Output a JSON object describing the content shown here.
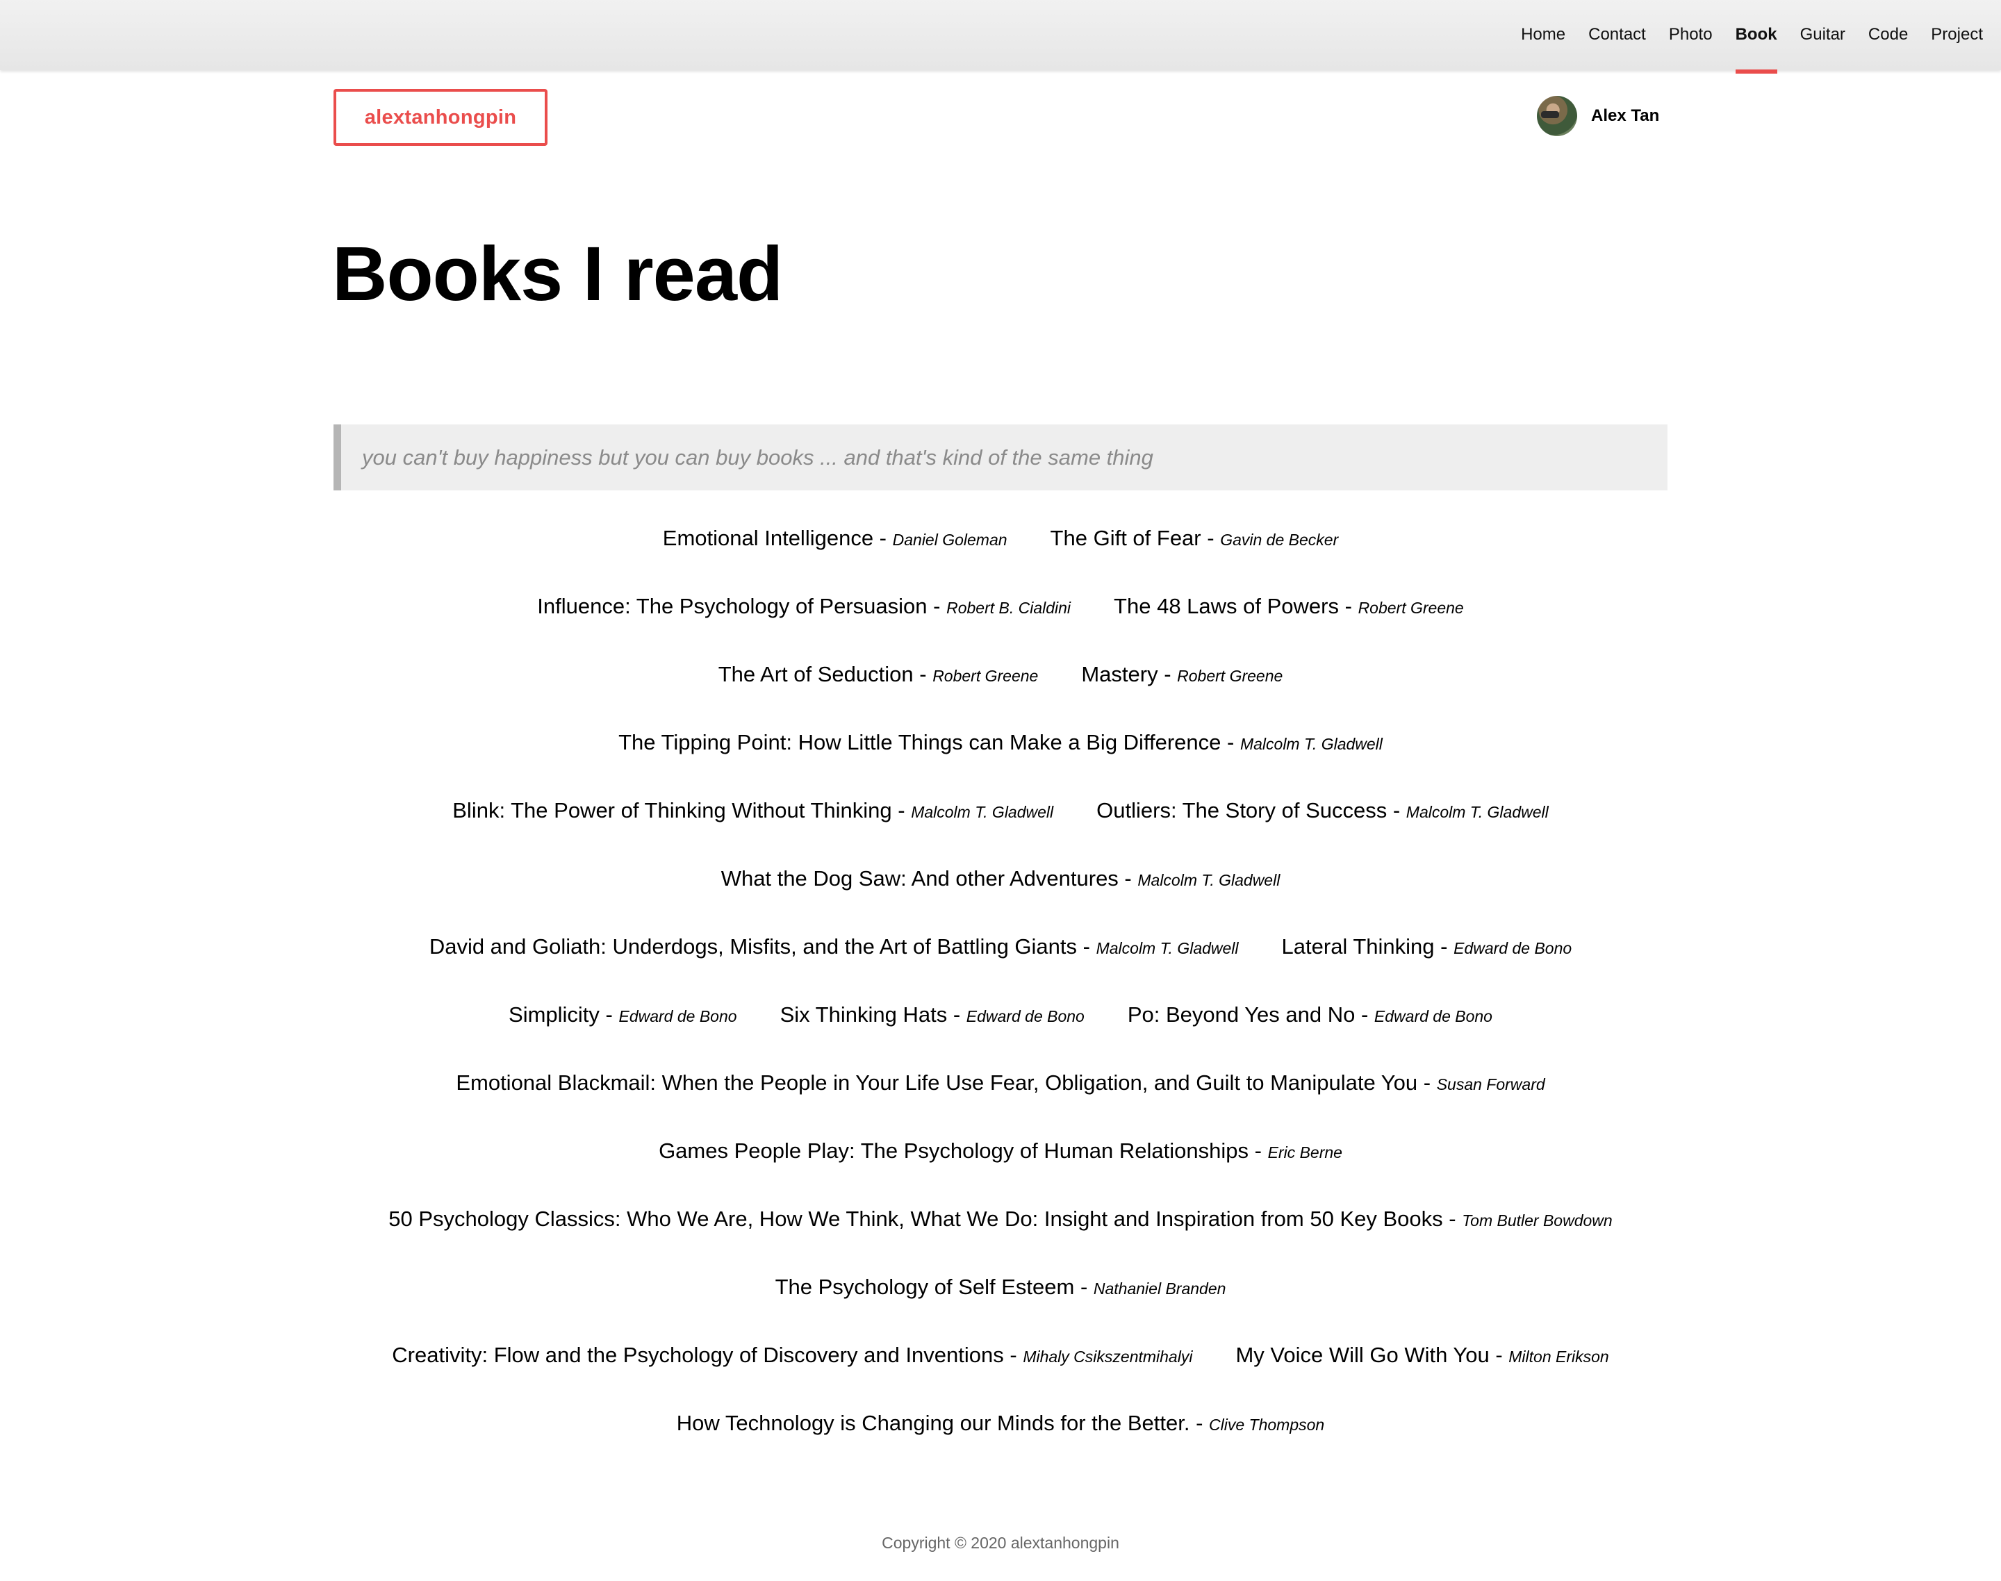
{
  "nav": {
    "items": [
      {
        "label": "Home",
        "active": false
      },
      {
        "label": "Contact",
        "active": false
      },
      {
        "label": "Photo",
        "active": false
      },
      {
        "label": "Book",
        "active": true
      },
      {
        "label": "Guitar",
        "active": false
      },
      {
        "label": "Code",
        "active": false
      },
      {
        "label": "Project",
        "active": false
      }
    ]
  },
  "brand": {
    "label": "alextanhongpin"
  },
  "user": {
    "name": "Alex Tan",
    "avatar_icon": "avatar-photo"
  },
  "page": {
    "title": "Books I read"
  },
  "quote": {
    "text": "you can't buy happiness but you can buy books ... and that's kind of the same thing"
  },
  "books": {
    "rows": [
      [
        {
          "title": "Emotional Intelligence",
          "author": "Daniel Goleman"
        },
        {
          "title": "The Gift of Fear",
          "author": "Gavin de Becker"
        }
      ],
      [
        {
          "title": "Influence: The Psychology of Persuasion",
          "author": "Robert B. Cialdini"
        },
        {
          "title": "The 48 Laws of Powers",
          "author": "Robert Greene"
        }
      ],
      [
        {
          "title": "The Art of Seduction",
          "author": "Robert Greene"
        },
        {
          "title": "Mastery",
          "author": "Robert Greene"
        }
      ],
      [
        {
          "title": "The Tipping Point: How Little Things can Make a Big Difference",
          "author": "Malcolm T. Gladwell"
        }
      ],
      [
        {
          "title": "Blink: The Power of Thinking Without Thinking",
          "author": "Malcolm T. Gladwell"
        },
        {
          "title": "Outliers: The Story of Success",
          "author": "Malcolm T. Gladwell"
        }
      ],
      [
        {
          "title": "What the Dog Saw: And other Adventures",
          "author": "Malcolm T. Gladwell"
        }
      ],
      [
        {
          "title": "David and Goliath: Underdogs, Misfits, and the Art of Battling Giants",
          "author": "Malcolm T. Gladwell"
        },
        {
          "title": "Lateral Thinking",
          "author": "Edward de Bono"
        }
      ],
      [
        {
          "title": "Simplicity",
          "author": "Edward de Bono"
        },
        {
          "title": "Six Thinking Hats",
          "author": "Edward de Bono"
        },
        {
          "title": "Po: Beyond Yes and No",
          "author": "Edward de Bono"
        }
      ],
      [
        {
          "title": "Emotional Blackmail: When the People in Your Life Use Fear, Obligation, and Guilt to Manipulate You",
          "author": "Susan Forward"
        }
      ],
      [
        {
          "title": "Games People Play: The Psychology of Human Relationships",
          "author": "Eric Berne"
        }
      ],
      [
        {
          "title": "50 Psychology Classics: Who We Are, How We Think, What We Do: Insight and Inspiration from 50 Key Books",
          "author": "Tom Butler Bowdown"
        }
      ],
      [
        {
          "title": "The Psychology of Self Esteem",
          "author": "Nathaniel Branden"
        }
      ],
      [
        {
          "title": "Creativity: Flow and the Psychology of Discovery and Inventions",
          "author": "Mihaly Csikszentmihalyi"
        },
        {
          "title": "My Voice Will Go With You",
          "author": "Milton Erikson"
        }
      ],
      [
        {
          "title": "How Technology is Changing our Minds for the Better.",
          "author": "Clive Thompson"
        }
      ]
    ],
    "separator": " - "
  },
  "footer": {
    "text": "Copyright © 2020 alextanhongpin"
  },
  "colors": {
    "accent": "#ea4d4c",
    "quote_bg": "#eeeeee",
    "quote_border": "#b5b5b5",
    "quote_text": "#8a8a8a"
  }
}
